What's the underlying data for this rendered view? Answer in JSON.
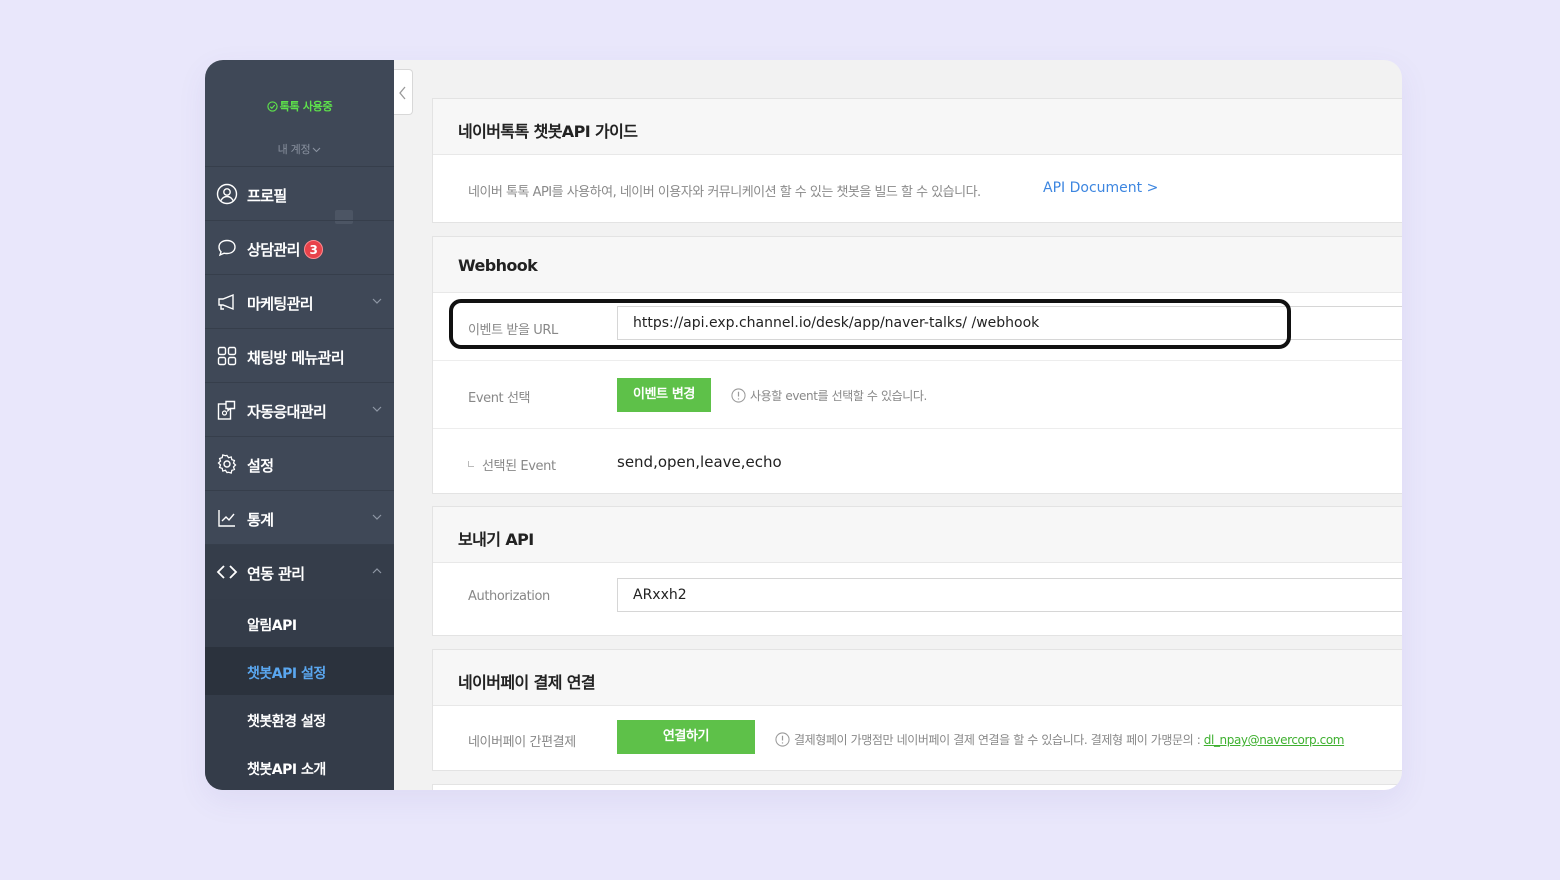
{
  "sidebar": {
    "status": "톡톡 사용중",
    "account": "내 계정",
    "items": [
      {
        "label": "프로필",
        "icon": "profile-icon"
      },
      {
        "label": "상담관리",
        "icon": "chat-icon",
        "badge": "3"
      },
      {
        "label": "마케팅관리",
        "icon": "megaphone-icon"
      },
      {
        "label": "채팅방 메뉴관리",
        "icon": "grid-icon"
      },
      {
        "label": "자동응대관리",
        "icon": "auto-reply-icon"
      },
      {
        "label": "설정",
        "icon": "gear-icon"
      },
      {
        "label": "통계",
        "icon": "chart-icon"
      },
      {
        "label": "연동 관리",
        "icon": "code-icon"
      }
    ],
    "submenu": [
      "알림API",
      "챗봇API 설정",
      "챗봇환경 설정",
      "챗봇API 소개"
    ]
  },
  "guide": {
    "title": "네이버톡톡 챗봇API 가이드",
    "text": "네이버 톡톡 API를 사용하여, 네이버 이용자와 커뮤니케이션 할 수 있는 챗봇을 빌드 할 수 있습니다.",
    "link": "API Document >"
  },
  "webhook": {
    "title": "Webhook",
    "url_label": "이벤트 받을 URL",
    "url_value": "https://api.exp.channel.io/desk/app/naver-talks/  /webhook",
    "event_label": "Event 선택",
    "event_button": "이벤트 변경",
    "event_hint": "사용할 event를 선택할 수 있습니다.",
    "selected_label": "선택된 Event",
    "selected_value": "send,open,leave,echo"
  },
  "send_api": {
    "title": "보내기 API",
    "auth_label": "Authorization",
    "auth_value": "ARxxh2"
  },
  "naverpay": {
    "title": "네이버페이 결제 연결",
    "label": "네이버페이 간편결제",
    "button": "연결하기",
    "hint": "결제형페이 가맹점만 네이버페이 결제 연결을 할 수 있습니다. 결제형 페이 가맹문의 : ",
    "email": "dl_npay@navercorp.com"
  },
  "colors": {
    "accent_green": "#5ec149",
    "sidebar_bg": "#3f4857",
    "link_blue": "#3d86e0",
    "badge_red": "#e8424a"
  }
}
